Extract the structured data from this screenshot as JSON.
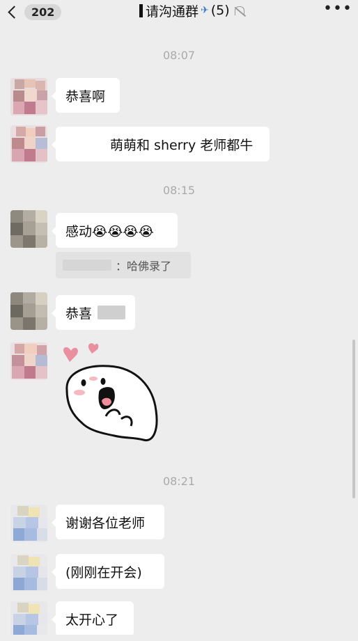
{
  "header": {
    "back_count": "202",
    "title": "请沟通群",
    "member_count": "(5)",
    "icons": [
      "chevron-left-icon",
      "airplane-icon",
      "bell-muted-icon",
      "more-icon"
    ]
  },
  "messages": [
    {
      "type": "time",
      "text": "08:07"
    },
    {
      "type": "text",
      "text": "恭喜啊"
    },
    {
      "type": "text",
      "text": "萌萌和 sherry 老师都牛"
    },
    {
      "type": "time",
      "text": "08:15"
    },
    {
      "type": "text",
      "text": "感动😭😭😭😭"
    },
    {
      "type": "quote",
      "text": "：哈佛录了"
    },
    {
      "type": "text",
      "text": "恭喜"
    },
    {
      "type": "sticker",
      "name": "blushing-ghost-sticker"
    },
    {
      "type": "time",
      "text": "08:21"
    },
    {
      "type": "text",
      "text": "谢谢各位老师"
    },
    {
      "type": "text",
      "text": "(刚刚在开会)"
    },
    {
      "type": "text",
      "text": "太开心了"
    }
  ],
  "colors": {
    "background": "#ededed",
    "bubble": "#ffffff",
    "timestamp": "#aaaaaa",
    "quote_bg": "#e2e2e2"
  }
}
